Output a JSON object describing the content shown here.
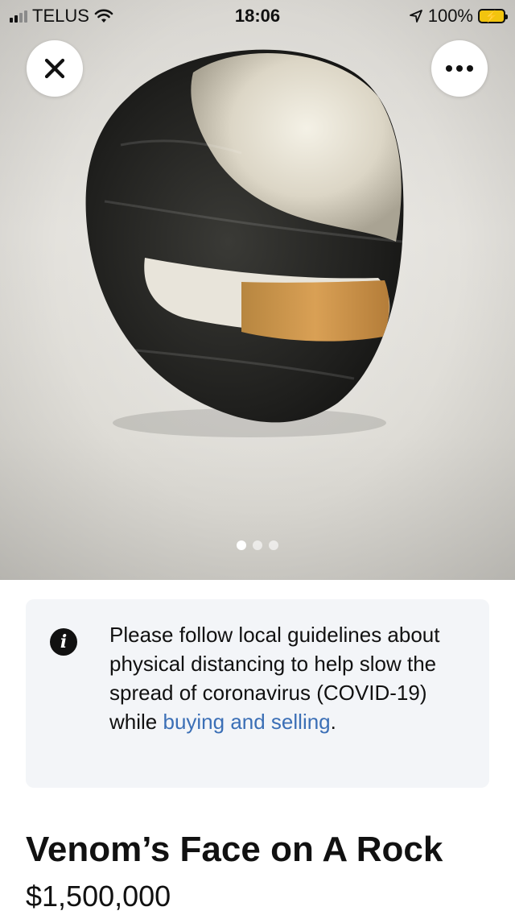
{
  "status_bar": {
    "carrier": "TELUS",
    "time": "18:06",
    "battery": "100%",
    "icons": [
      "signal-icon",
      "wifi-icon",
      "location-arrow-icon",
      "battery-charging-icon"
    ]
  },
  "header": {
    "close_icon": "close-icon",
    "more_icon": "more-options-icon"
  },
  "gallery": {
    "image_description_icon": "listing-photo",
    "page_count": 3,
    "active_page": 1
  },
  "notice": {
    "icon": "info-icon",
    "text": "Please follow local guidelines about physical distancing to help slow the spread of coronavirus (COVID-19) while ",
    "link_text": "buying and selling",
    "suffix": ".",
    "link_color": "#3b6fb6"
  },
  "listing": {
    "title": "Venom’s Face on A Rock",
    "price": "$1,500,000"
  }
}
